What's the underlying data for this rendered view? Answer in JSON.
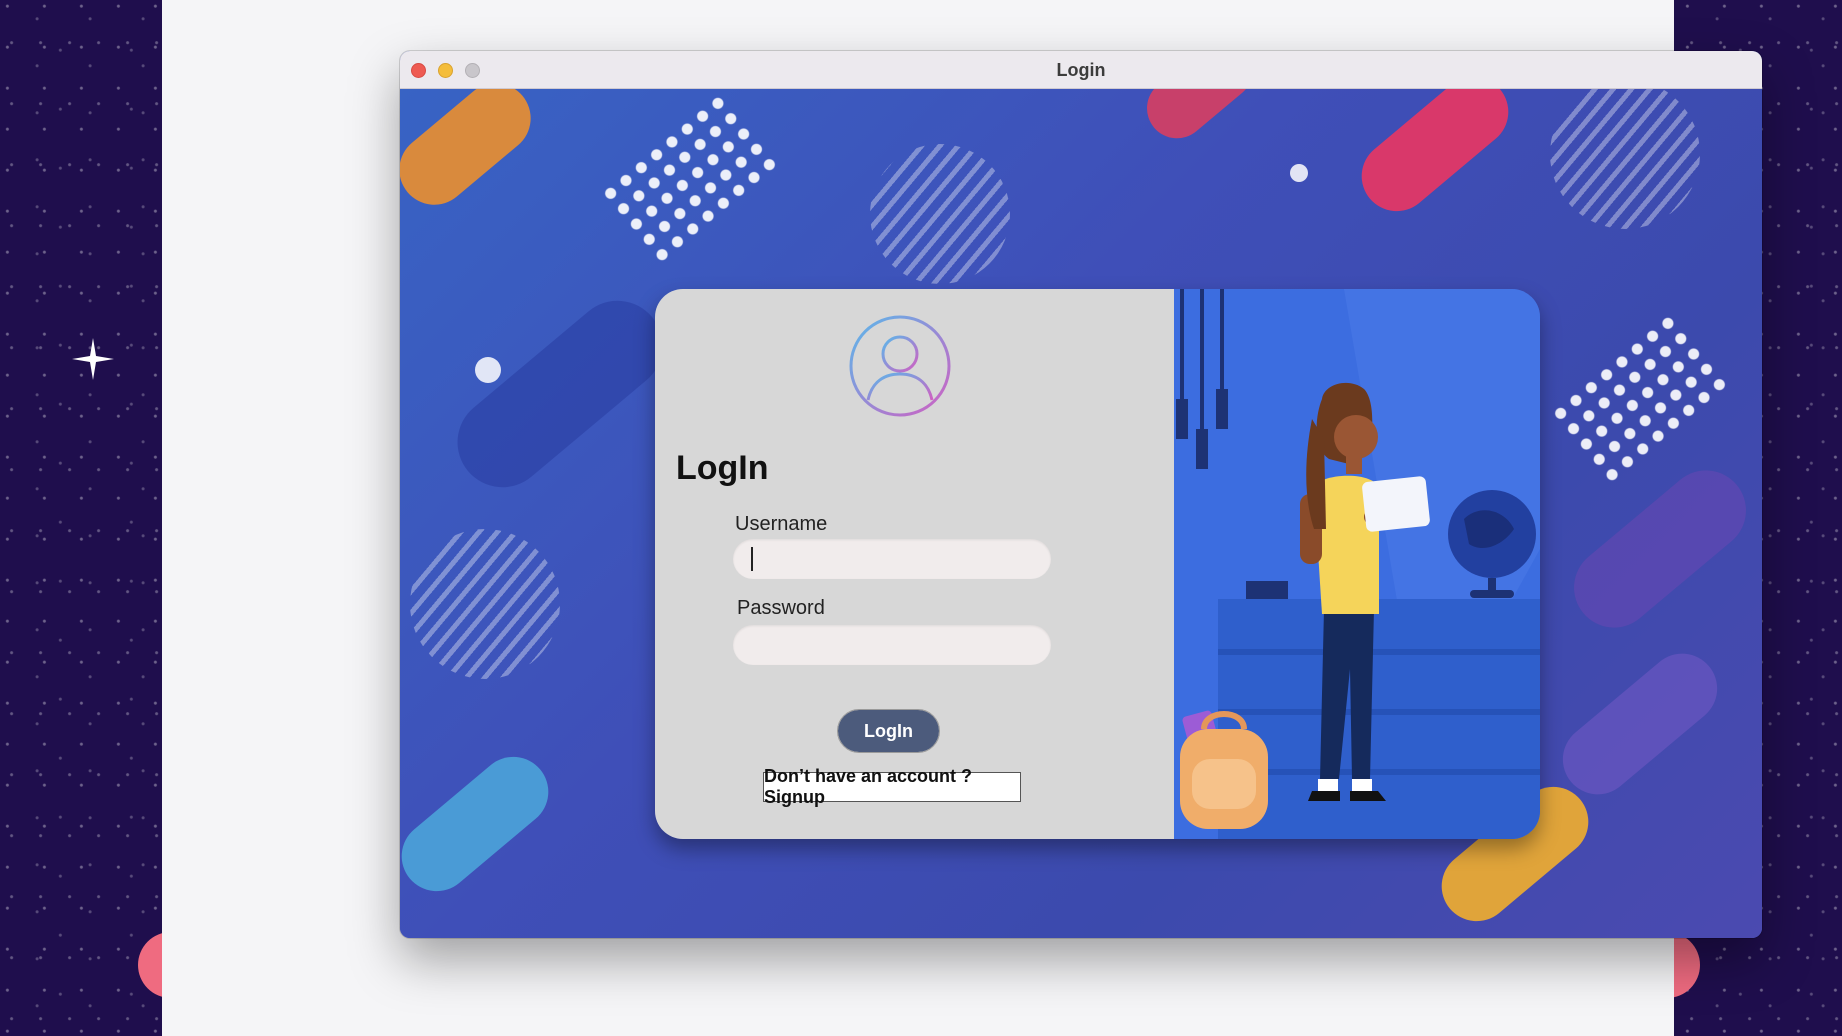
{
  "window": {
    "title": "Login"
  },
  "login_form": {
    "heading": "LogIn",
    "username_label": "Username",
    "username_value": "",
    "password_label": "Password",
    "password_value": "",
    "login_button": "LogIn",
    "signup_link": "Don’t have an account ? Signup"
  },
  "icons": {
    "user_avatar": "user-avatar-icon",
    "sparkle": "sparkle-icon"
  },
  "colors": {
    "card_left_bg": "#d7d7d7",
    "card_right_bg": "#3c6de0",
    "login_button_bg": "#4c5b7c",
    "window_bg_accent": "#3b5ac8"
  }
}
